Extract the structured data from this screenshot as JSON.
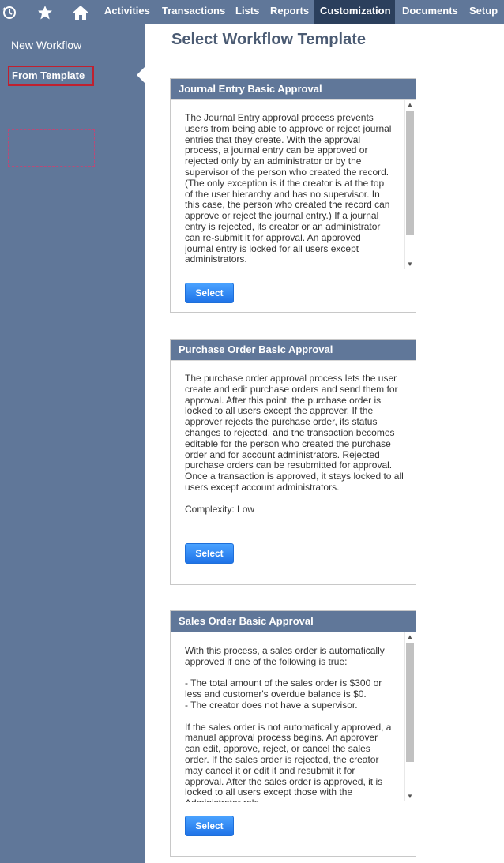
{
  "nav": {
    "icons": [
      "history-icon",
      "star-icon",
      "home-icon"
    ],
    "items": [
      {
        "label": "Activities",
        "active": false
      },
      {
        "label": "Transactions",
        "active": false
      },
      {
        "label": "Lists",
        "active": false
      },
      {
        "label": "Reports",
        "active": false
      },
      {
        "label": "Customization",
        "active": true
      },
      {
        "label": "Documents",
        "active": false
      },
      {
        "label": "Setup",
        "active": false
      }
    ]
  },
  "sidebar": {
    "new_workflow": "New Workflow",
    "from_template": "From Template"
  },
  "page": {
    "title": "Select Workflow Template"
  },
  "templates": [
    {
      "title": "Journal Entry Basic Approval",
      "description": "The Journal Entry approval process prevents users from being able to approve or reject journal entries that they create. With the approval process, a journal entry can be approved or rejected only by an administrator or by the supervisor of the person who created the record. (The only exception is if the creator is at the top of the user hierarchy and has no supervisor. In this case, the person who created the record can approve or reject the journal entry.) If a journal entry is rejected, its creator or an administrator can re-submit it for approval. An approved journal entry is locked for all users except administrators.",
      "select_label": "Select"
    },
    {
      "title": "Purchase Order Basic Approval",
      "description": "The purchase order approval process lets the user create and edit purchase orders and send them for approval. After this point, the purchase order is locked to all users except the approver. If the approver rejects the purchase order, its status changes to rejected, and the transaction becomes editable for the person who created the purchase order and for account administrators. Rejected purchase orders can be resubmitted for approval. Once a transaction is approved, it stays locked to all users except account administrators.\n\nComplexity: Low",
      "select_label": "Select"
    },
    {
      "title": "Sales Order Basic Approval",
      "description": "With this process, a sales order is automatically approved if one of the following is true:\n\n- The total amount of the sales order is $300 or less and customer's overdue balance is $0.\n- The creator does not have a supervisor.\n\nIf the sales order is not automatically approved, a manual approval process begins. An approver can edit, approve, reject, or cancel the sales order. If the sales order is rejected, the creator may cancel it or edit it and resubmit it for approval. After the sales order is approved, it is locked to all users except those with the Administrator role.",
      "select_label": "Select"
    }
  ]
}
